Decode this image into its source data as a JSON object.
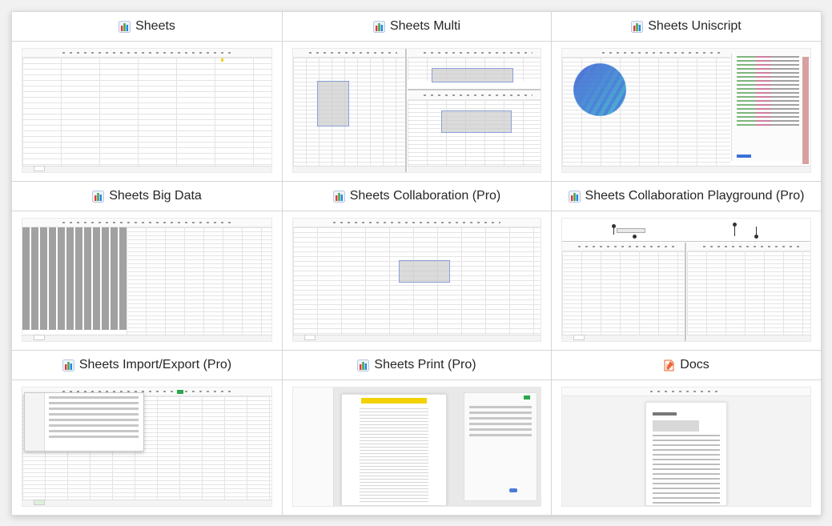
{
  "cards": [
    {
      "title": "Sheets",
      "icon": "sheets-icon"
    },
    {
      "title": "Sheets Multi",
      "icon": "sheets-icon"
    },
    {
      "title": "Sheets Uniscript",
      "icon": "sheets-icon"
    },
    {
      "title": "Sheets Big Data",
      "icon": "sheets-icon"
    },
    {
      "title": "Sheets Collaboration (Pro)",
      "icon": "sheets-icon"
    },
    {
      "title": "Sheets Collaboration Playground (Pro)",
      "icon": "sheets-icon"
    },
    {
      "title": "Sheets Import/Export (Pro)",
      "icon": "sheets-icon"
    },
    {
      "title": "Sheets Print (Pro)",
      "icon": "sheets-icon"
    },
    {
      "title": "Docs",
      "icon": "docs-icon"
    }
  ],
  "colors": {
    "sheets_bar_1": "#e53935",
    "sheets_bar_2": "#43a047",
    "sheets_bar_3": "#1e88e5",
    "docs_icon": "#e8673a",
    "selection": "#c8c8c8",
    "print_header": "#f2d200"
  }
}
